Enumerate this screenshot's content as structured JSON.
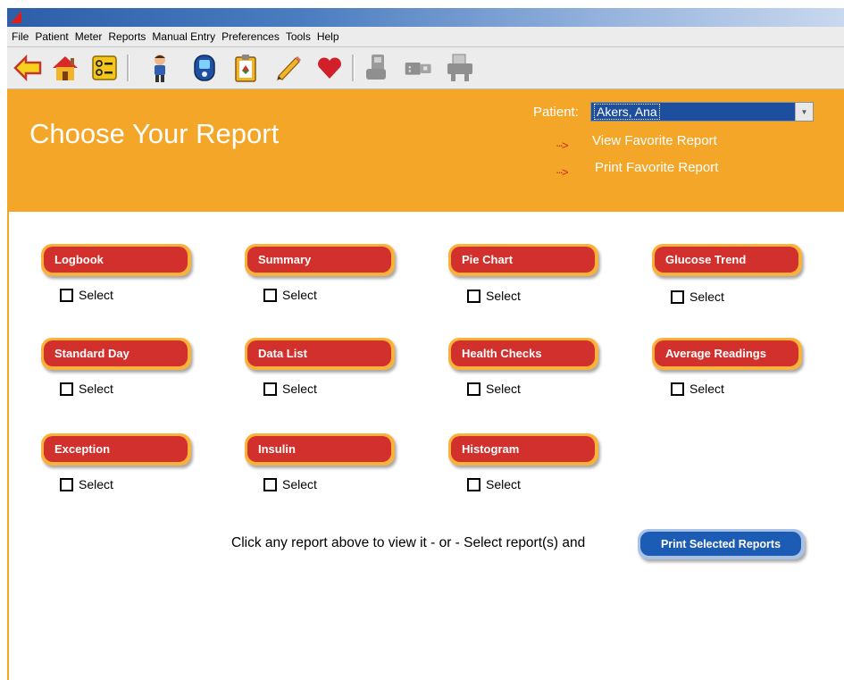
{
  "menu": [
    "File",
    "Patient",
    "Meter",
    "Reports",
    "Manual Entry",
    "Preferences",
    "Tools",
    "Help"
  ],
  "toolbar": [
    "back-arrow-icon",
    "home-icon",
    "patient-list-icon",
    "patient-icon",
    "meter-icon",
    "clipboard-icon",
    "pencil-icon",
    "heart-icon",
    "device-icon",
    "connector-icon",
    "printer-icon"
  ],
  "banner": {
    "title": "Choose Your Report",
    "patient_label": "Patient:",
    "patient_value": "Akers, Ana",
    "view_favorite": "View Favorite Report",
    "print_favorite": "Print Favorite Report",
    "arrow": "···>"
  },
  "reports": [
    {
      "label": "Logbook",
      "select": "Select"
    },
    {
      "label": "Summary",
      "select": "Select"
    },
    {
      "label": "Pie Chart",
      "select": "Select"
    },
    {
      "label": "Glucose Trend",
      "select": "Select"
    },
    {
      "label": "Standard Day",
      "select": "Select"
    },
    {
      "label": "Data List",
      "select": "Select"
    },
    {
      "label": "Health Checks",
      "select": "Select"
    },
    {
      "label": "Average Readings",
      "select": "Select"
    },
    {
      "label": "Exception",
      "select": "Select"
    },
    {
      "label": "Insulin",
      "select": "Select"
    },
    {
      "label": "Histogram",
      "select": "Select"
    }
  ],
  "footer": {
    "instruction": "Click any report above to view it - or - Select report(s) and",
    "print_button": "Print Selected Reports"
  },
  "colors": {
    "banner": "#f4a629",
    "report_button": "#d2302c",
    "print_button": "#1d5cb4",
    "patient_select": "#1d4f9e"
  }
}
